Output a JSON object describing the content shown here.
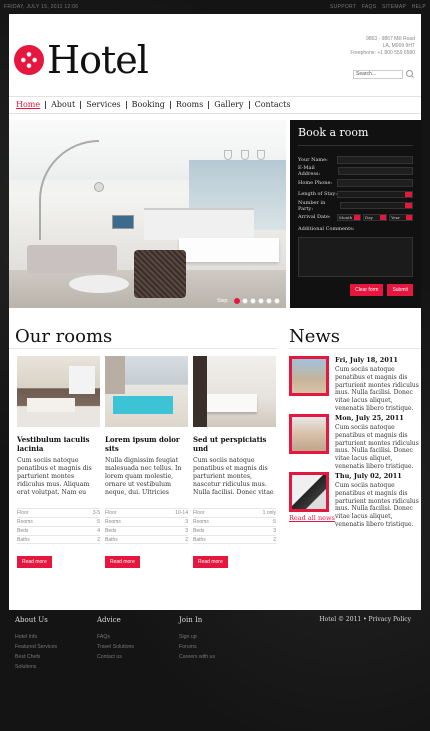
{
  "topbar": {
    "date": "FRIDAY, JULY 15, 2011 12:06",
    "links": [
      "SUPPORT",
      "FAQS",
      "SITEMAP",
      "HELP"
    ]
  },
  "header": {
    "logo_text": "Hotel",
    "address": [
      "9863 - 9867 Mill Road",
      "LA, M009 9HT"
    ],
    "freephone_label": "Freephone:",
    "freephone": "+1 800 559 6580",
    "search_placeholder": "Search..."
  },
  "nav": [
    "Home",
    "About",
    "Services",
    "Booking",
    "Rooms",
    "Gallery",
    "Contacts"
  ],
  "hero": {
    "step_label": "Step:",
    "slide_count": 6,
    "active_slide": 1
  },
  "booking": {
    "title": "Book a room",
    "fields": {
      "name": "Your Name:",
      "email": "E-Mail Address:",
      "phone": "Home Phone:",
      "stay": "Length of Stay:",
      "party": "Number in Party:",
      "arrival": "Arrival Date:",
      "info": "Additional Comments:"
    },
    "arrival_parts": [
      "Month",
      "Day",
      "Year"
    ],
    "clear_label": "Clear form",
    "submit_label": "Submit"
  },
  "rooms": {
    "title": "Our rooms",
    "items": [
      {
        "title": "Vestibulum iaculis lacinia",
        "text": "Cum sociis natoque penatibus et magnis dis parturient montes ridiculus mus. Aliquam erat volutpat. Nam eu quam tristique venenatis ante ac dolor felis ultrices. Donec accumsan rhoncus ornare quis ornare. Donec nec lorem.",
        "specs": [
          [
            "Floor",
            "3-5"
          ],
          [
            "Rooms",
            "5"
          ],
          [
            "Beds",
            "4"
          ],
          [
            "Baths",
            "2"
          ]
        ],
        "button": "Read more"
      },
      {
        "title": "Lorem ipsum dolor sits",
        "text": "Nulla dignissim feugiat malesuada nec tellus. In lorem quam molestie, ornare ut vestibulum neque, dui. Ultricies suscipit ac, eget magna. Maecenas adipiscing elit, aliquam et interdum. Sed laoreet aliquam dolor. Donec feugiat ut elit.",
        "specs": [
          [
            "Floor",
            "10-14"
          ],
          [
            "Rooms",
            "3"
          ],
          [
            "Beds",
            "3"
          ],
          [
            "Baths",
            "2"
          ]
        ],
        "button": "Read more"
      },
      {
        "title": "Sed ut perspiciatis und",
        "text": "Cum sociis natoque penatibus et magnis dis parturient montes, nascetur ridiculus mus. Nulla facilisi. Donec vitae dolor lacus. Donec accumsan tincidunt felis, eget adipiscing eros ornare sit amet. Donec faucibus orci.",
        "specs": [
          [
            "Floor",
            "1 only"
          ],
          [
            "Rooms",
            "5"
          ],
          [
            "Beds",
            "3"
          ],
          [
            "Baths",
            "2"
          ]
        ],
        "button": "Read more"
      }
    ]
  },
  "news": {
    "title": "News",
    "items": [
      {
        "date": "Fri, July 18, 2011",
        "text": "Cum sociis natoque penatibus et magnis dis parturient montes ridiculus mus. Nulla facilisi. Donec vitae lacus aliquet, venenatis libero tristique."
      },
      {
        "date": "Mon, July 25, 2011",
        "text": "Cum sociis natoque penatibus et magnis dis parturient montes ridiculus mus. Nulla facilisi. Donec vitae lacus aliquet, venenatis libero tristique."
      },
      {
        "date": "Thu, July 02, 2011",
        "text": "Cum sociis natoque penatibus et magnis dis parturient montes ridiculus mus. Nulla facilisi. Donec vitae lacus aliquet, venenatis libero tristique."
      }
    ],
    "read_all": "Read all news"
  },
  "footer": {
    "columns": [
      {
        "title": "About Us",
        "links": [
          "Hotel Info",
          "Featured Services",
          "Best Chefs",
          "Solutions"
        ]
      },
      {
        "title": "Advice",
        "links": [
          "FAQs",
          "Travel Solutions",
          "Contact us"
        ]
      },
      {
        "title": "Join In",
        "links": [
          "Sign up",
          "Forums",
          "Careers with us"
        ]
      }
    ],
    "copyright": "Hotel © 2011 • Privacy Policy"
  },
  "colors": {
    "accent": "#e5173f",
    "dark": "#111111"
  }
}
